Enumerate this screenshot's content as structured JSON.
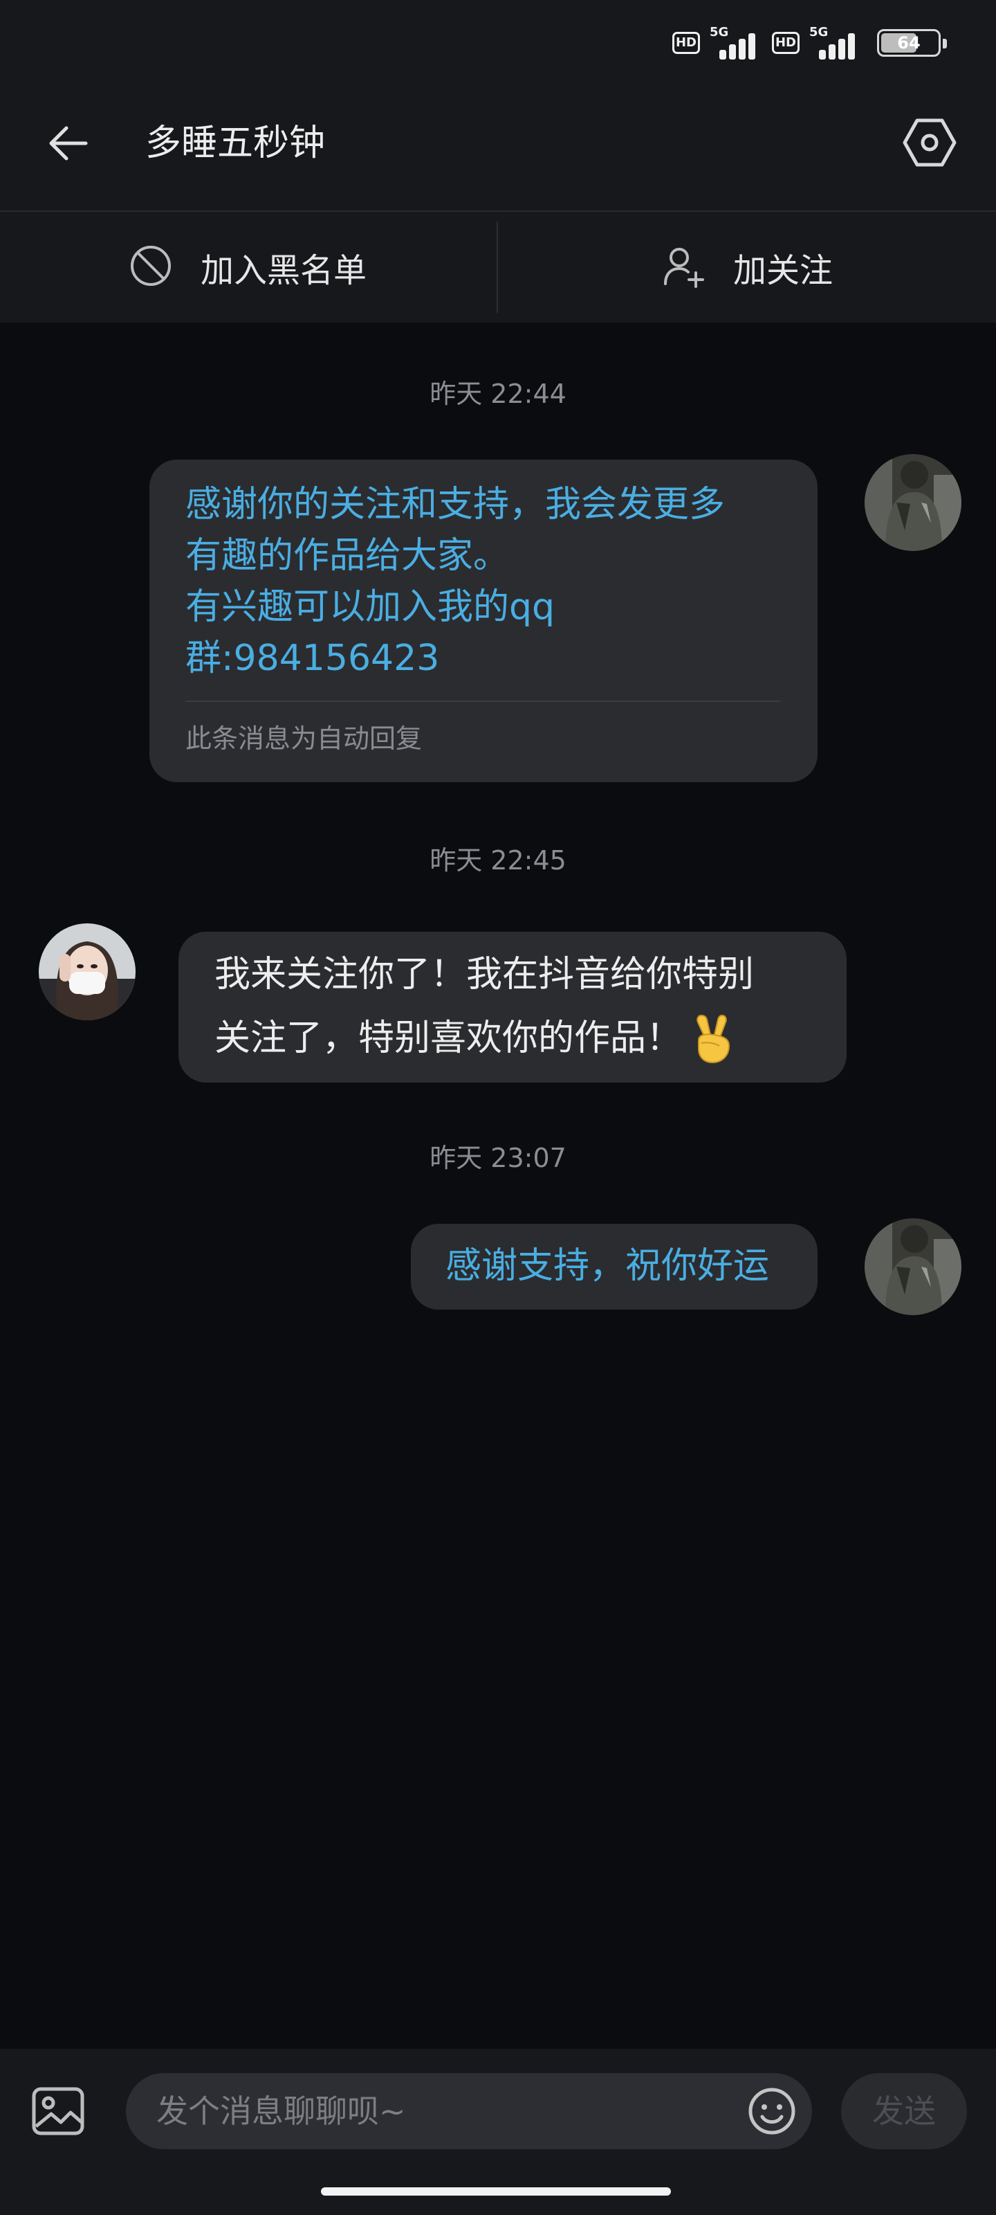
{
  "status_bar": {
    "hd_badge_1": "HD",
    "network_1": "5G",
    "hd_badge_2": "HD",
    "network_2": "5G",
    "battery_level": "64"
  },
  "header": {
    "title": "多睡五秒钟"
  },
  "action_bar": {
    "block_label": "加入黑名单",
    "follow_label": "加关注"
  },
  "conversation": {
    "timestamps": [
      "昨天 22:44",
      "昨天 22:45",
      "昨天 23:07"
    ],
    "messages": [
      {
        "side": "right",
        "lines": [
          "感谢你的关注和支持，我会发更多",
          "有趣的作品给大家。",
          "有兴趣可以加入我的qq",
          "群:984156423"
        ],
        "note": "此条消息为自动回复"
      },
      {
        "side": "left",
        "lines": [
          "我来关注你了！我在抖音给你特别",
          "关注了，特别喜欢你的作品！"
        ],
        "emoji": "victory-hand-emoji"
      },
      {
        "side": "right",
        "lines": [
          "感谢支持，祝你好运"
        ]
      }
    ]
  },
  "input_bar": {
    "placeholder": "发个消息聊聊呗~",
    "value": "",
    "send_label": "发送"
  },
  "colors": {
    "background": "#0b0c0f",
    "header_bg": "#17181c",
    "bubble_bg": "#2b2c30",
    "link_blue": "#4aaee2",
    "muted_text": "#8c8d92"
  },
  "icons": [
    "back-arrow-icon",
    "settings-hexagon-icon",
    "block-icon",
    "add-user-icon",
    "image-icon",
    "emoji-icon"
  ]
}
